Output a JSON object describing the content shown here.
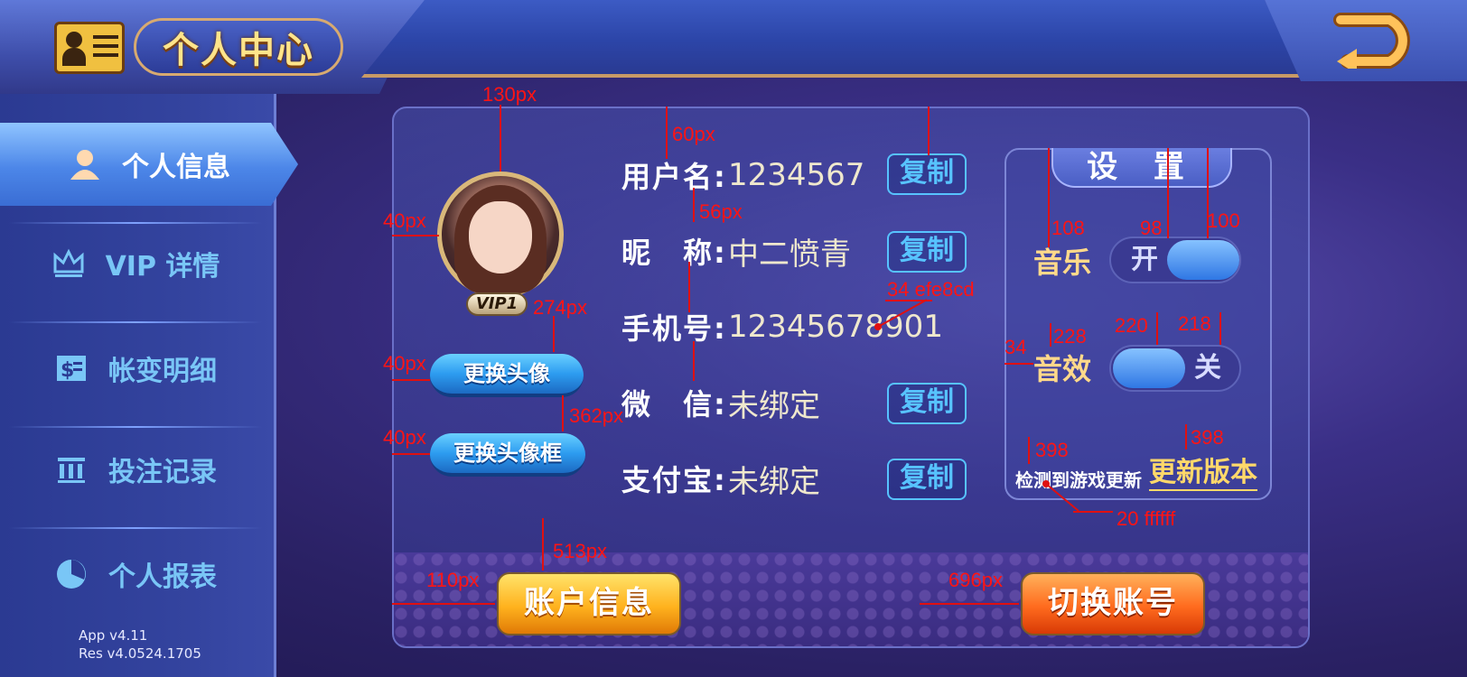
{
  "header": {
    "title": "个人中心"
  },
  "sidebar": {
    "items": [
      {
        "label": "个人信息",
        "icon": "person-icon",
        "active": true
      },
      {
        "label": "VIP 详情",
        "icon": "crown-icon",
        "active": false
      },
      {
        "label": "帐变明细",
        "icon": "bill-icon",
        "active": false
      },
      {
        "label": "投注记录",
        "icon": "record-icon",
        "active": false
      },
      {
        "label": "个人报表",
        "icon": "pie-chart-icon",
        "active": false
      }
    ],
    "app_version": "App  v4.11",
    "res_version": "Res  v4.0524.1705"
  },
  "profile": {
    "vip_level": "VIP1",
    "change_avatar": "更换头像",
    "change_frame": "更换头像框",
    "rows": [
      {
        "label": "用户名:",
        "value": "1234567",
        "copy": "复制"
      },
      {
        "label": "昵　称:",
        "value": "中二愤青",
        "copy": "复制"
      },
      {
        "label": "手机号:",
        "value": "12345678901"
      },
      {
        "label": "微　信:",
        "value": "未绑定",
        "copy": "复制"
      },
      {
        "label": "支付宝:",
        "value": "未绑定",
        "copy": "复制"
      }
    ]
  },
  "settings": {
    "title": "设 置",
    "music_label": "音乐",
    "music_state": "开",
    "sound_label": "音效",
    "sound_state": "关",
    "update_note": "检测到游戏更新",
    "update_link": "更新版本"
  },
  "footer": {
    "account_info": "账户信息",
    "switch_account": "切换账号"
  },
  "annotations": {
    "a1": "130px",
    "a2": "60px",
    "a3": "56px",
    "a4": "40px",
    "a5": "274px",
    "a6": "40px",
    "a7": "362px",
    "a8": "40px",
    "a9": "34 efe8cd",
    "a10": "108",
    "a11": "98",
    "a12": "100",
    "a13": "228",
    "a14": "34",
    "a15": "220",
    "a16": "218",
    "a17": "398",
    "a18": "398",
    "a19": "20 ffffff",
    "a20": "513px",
    "a21": "110px",
    "a22": "696px"
  },
  "colors": {
    "accent_text": "#efe8cd",
    "copy_button": "#57c3ff",
    "settings_label": "#ffd98a",
    "annotation": "#ff1414"
  }
}
